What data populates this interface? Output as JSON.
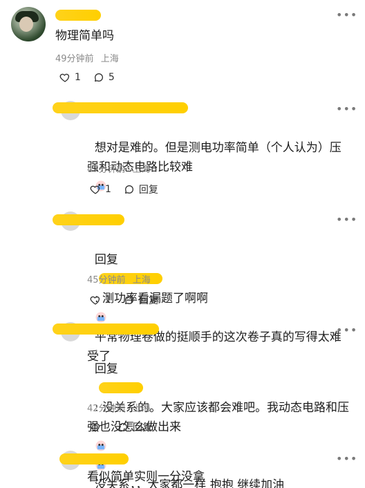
{
  "comments": [
    {
      "text": "物理简单吗",
      "time": "49分钟前",
      "location": "上海",
      "like_count": "1",
      "reply_count": "5"
    },
    {
      "text": "想对是难的。但是测电功率简单（个人认为）压强和动态电路比较难",
      "time": "47分钟前",
      "location": "上海",
      "like_count": "1",
      "reply_label": "回复"
    },
    {
      "reply_prefix": "回复",
      "text_after_user": ": 测功率看漏题了啊啊",
      "text_more": "平常物理卷做的挺顺手的这次卷子真的写得太难受了",
      "time": "45分钟前",
      "location": "上海",
      "like_count": "1",
      "reply_label": "回复"
    },
    {
      "reply_prefix": "回复",
      "text_after_user": ": 没关系的。大家应该都会难吧。我动态电路和压强也没怎么做出来",
      "text_more": "没关系，，大家都一样 抱抱 继续加油",
      "time": "42分钟前",
      "location": "上海",
      "like_count": "",
      "reply_label": "回复"
    },
    {
      "text": "看似简单实则一分没拿"
    }
  ],
  "icons": {
    "more": "more-icon",
    "like": "heart-icon",
    "reply": "comment-icon",
    "emoji": "emoji-icon"
  }
}
